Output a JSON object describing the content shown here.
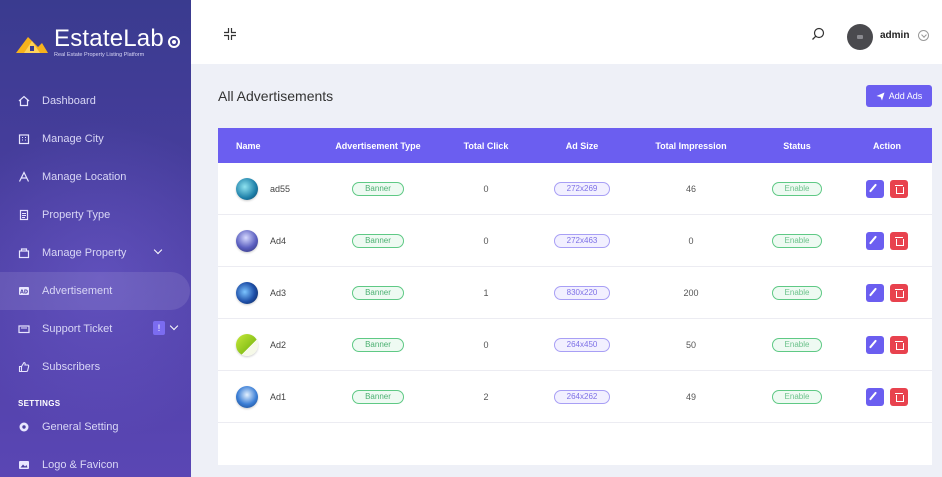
{
  "brand": {
    "name": "EstateLab",
    "tagline": "Real Estate Property Listing Platform"
  },
  "sidebar": {
    "items": [
      {
        "label": "Dashboard",
        "icon": "home-icon"
      },
      {
        "label": "Manage City",
        "icon": "building-icon"
      },
      {
        "label": "Manage Location",
        "icon": "location-icon"
      },
      {
        "label": "Property Type",
        "icon": "document-icon"
      },
      {
        "label": "Manage Property",
        "icon": "property-icon",
        "has_submenu": true
      },
      {
        "label": "Advertisement",
        "icon": "ad-icon",
        "active": true
      },
      {
        "label": "Support Ticket",
        "icon": "ticket-icon",
        "badge": "!",
        "has_submenu": true
      },
      {
        "label": "Subscribers",
        "icon": "thumbs-up-icon"
      }
    ],
    "settings_label": "SETTINGS",
    "settings_items": [
      {
        "label": "General Setting",
        "icon": "gear-icon"
      },
      {
        "label": "Logo & Favicon",
        "icon": "image-icon"
      }
    ]
  },
  "topbar": {
    "user_name": "admin"
  },
  "main": {
    "title": "All Advertisements",
    "add_button_label": "Add Ads"
  },
  "table": {
    "headers": [
      "Name",
      "Advertisement Type",
      "Total Click",
      "Ad Size",
      "Total Impression",
      "Status",
      "Action"
    ],
    "rows": [
      {
        "name": "ad55",
        "type": "Banner",
        "clicks": "0",
        "size": "272x269",
        "impressions": "46",
        "status": "Enable"
      },
      {
        "name": "Ad4",
        "type": "Banner",
        "clicks": "0",
        "size": "272x463",
        "impressions": "0",
        "status": "Enable"
      },
      {
        "name": "Ad3",
        "type": "Banner",
        "clicks": "1",
        "size": "830x220",
        "impressions": "200",
        "status": "Enable"
      },
      {
        "name": "Ad2",
        "type": "Banner",
        "clicks": "0",
        "size": "264x450",
        "impressions": "50",
        "status": "Enable"
      },
      {
        "name": "Ad1",
        "type": "Banner",
        "clicks": "2",
        "size": "264x262",
        "impressions": "49",
        "status": "Enable"
      }
    ]
  },
  "colors": {
    "accent": "#6b5ef0",
    "danger": "#e8424e",
    "success": "#5fc985",
    "sidebar_top": "#3a3b8f",
    "sidebar_bottom": "#5a46b4"
  }
}
